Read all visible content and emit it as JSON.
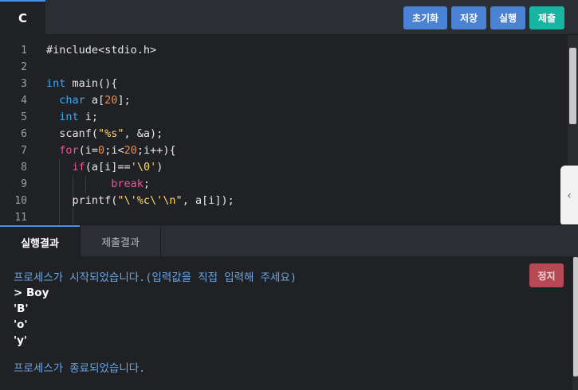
{
  "toolbar": {
    "language_tab": "C",
    "reset_label": "초기화",
    "save_label": "저장",
    "run_label": "실행",
    "submit_label": "제출"
  },
  "editor": {
    "line_numbers": [
      "1",
      "2",
      "3",
      "4",
      "5",
      "6",
      "7",
      "8",
      "9",
      "10",
      "11"
    ],
    "lines": [
      "#include<stdio.h>",
      "",
      "int main(){",
      "  char a[20];",
      "  int i;",
      "  scanf(\"%s\", &a);",
      "  for(i=0;i<20;i++){",
      "    if(a[i]=='\\0')",
      "          break;",
      "    printf(\"\\'%c\\'\\n\", a[i]);",
      ""
    ]
  },
  "output": {
    "tabs": [
      "실행결과",
      "제출결과"
    ],
    "stop_label": "정지",
    "lines": [
      {
        "text": "프로세스가 시작되었습니다.(입력값을 직접 입력해 주세요)",
        "kind": "system"
      },
      {
        "text": "> Boy",
        "kind": "user"
      },
      {
        "text": "'B'",
        "kind": "user"
      },
      {
        "text": "'o'",
        "kind": "user"
      },
      {
        "text": "'y'",
        "kind": "user"
      },
      {
        "text": "",
        "kind": "user"
      },
      {
        "text": "프로세스가 종료되었습니다.",
        "kind": "system"
      }
    ]
  },
  "colors": {
    "accent_blue": "#4a82d4",
    "submit_teal": "#18b5a3",
    "stop_red": "#b54a55",
    "system_text": "#6aa6e8"
  }
}
